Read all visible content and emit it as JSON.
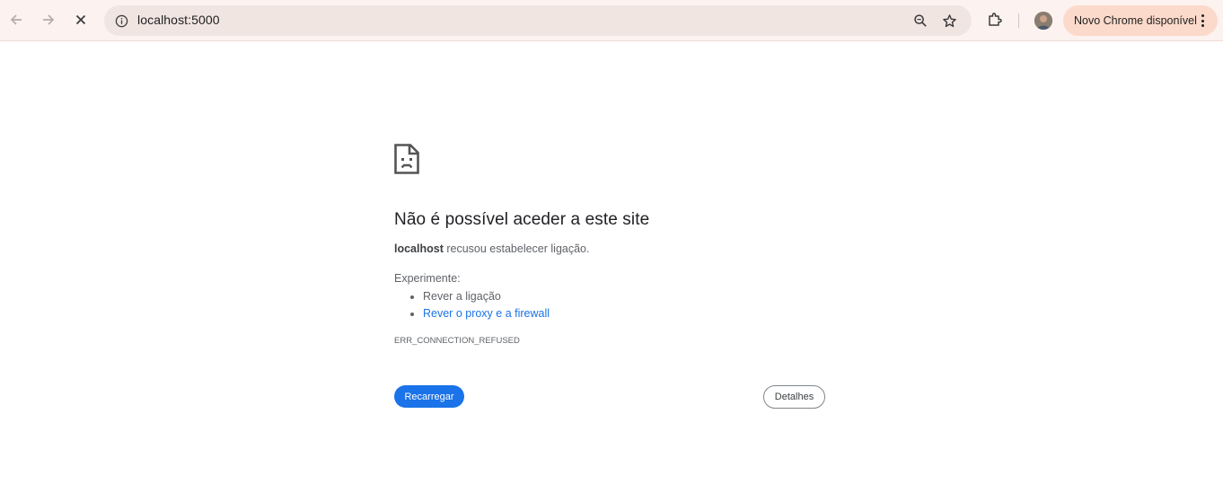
{
  "browser": {
    "url": "localhost:5000",
    "update_chip_label": "Novo Chrome disponível",
    "icons": [
      "back-arrow-icon",
      "forward-arrow-icon",
      "stop-loading-icon",
      "site-info-icon",
      "zoom-icon",
      "bookmark-star-icon",
      "extensions-icon",
      "profile-avatar",
      "more-vert-icon"
    ]
  },
  "error_page": {
    "icon": "sad-page-icon",
    "heading": "Não é possível aceder a este site",
    "host": "localhost",
    "summary_rest": " recusou estabelecer ligação.",
    "try_label": "Experimente:",
    "suggestions": [
      {
        "text": "Rever a ligação",
        "link": false
      },
      {
        "text": "Rever o proxy e a firewall",
        "link": true
      }
    ],
    "error_code": "ERR_CONNECTION_REFUSED",
    "reload_label": "Recarregar",
    "details_label": "Detalhes"
  },
  "colors": {
    "toolbar_bg": "#fcf2ef",
    "omnibox_bg": "#f1e5e2",
    "update_chip_bg": "#fcdacb",
    "primary_button": "#1a73e8",
    "link": "#1a73e8"
  }
}
